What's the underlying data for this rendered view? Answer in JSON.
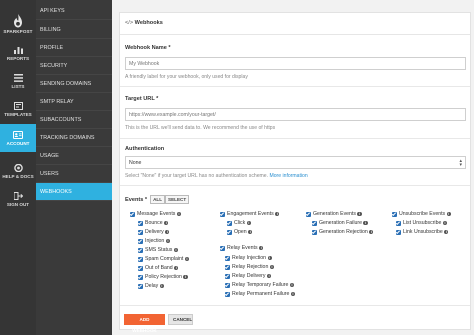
{
  "rail": {
    "logo": "SPARKPOST",
    "items": [
      {
        "label": "REPORTS",
        "icon": "bar-chart-icon"
      },
      {
        "label": "LISTS",
        "icon": "list-icon"
      },
      {
        "label": "TEMPLATES",
        "icon": "template-icon"
      },
      {
        "label": "ACCOUNT",
        "icon": "account-icon"
      },
      {
        "label": "HELP & DOCS",
        "icon": "help-icon"
      },
      {
        "label": "SIGN OUT",
        "icon": "sign-out-icon"
      }
    ]
  },
  "subnav": {
    "items": [
      "API KEYS",
      "BILLING",
      "PROFILE",
      "SECURITY",
      "SENDING DOMAINS",
      "SMTP RELAY",
      "SUBACCOUNTS",
      "TRACKING DOMAINS",
      "USAGE",
      "USERS",
      "WEBHOOKS"
    ],
    "active": "WEBHOOKS"
  },
  "page": {
    "title_icon": "</>",
    "title": "Webhooks",
    "name_label": "Webhook Name *",
    "name_placeholder": "My Webhook",
    "name_hint": "A friendly label for your webhook, only used for display",
    "url_label": "Target URL *",
    "url_placeholder": "https://www.example.com/your-target/",
    "url_hint": "This is the URL we'll send data to. We recommend the use of https",
    "auth_label": "Authentication",
    "auth_value": "None",
    "auth_hint": "Select \"None\" if your target URL has no authentication scheme.",
    "auth_hint_link": "More information",
    "events_label": "Events *",
    "all_button": "ALL",
    "select_button": "SELECT",
    "add_button": "ADD WEBHOOK",
    "cancel_button": "CANCEL"
  },
  "events": {
    "message": {
      "title": "Message Events",
      "items": [
        "Bounce",
        "Delivery",
        "Injection",
        "SMS Status",
        "Spam Complaint",
        "Out of Band",
        "Policy Rejection",
        "Delay"
      ]
    },
    "engagement": {
      "title": "Engagement Events",
      "items": [
        "Click",
        "Open"
      ]
    },
    "relay": {
      "title": "Relay Events",
      "items": [
        "Relay Injection",
        "Relay Rejection",
        "Relay Delivery",
        "Relay Temporary Failure",
        "Relay Permanent Failure"
      ]
    },
    "generation": {
      "title": "Generation Events",
      "items": [
        "Generation Failure",
        "Generation Rejection"
      ]
    },
    "unsubscribe": {
      "title": "Unsubscribe Events",
      "items": [
        "List Unsubscribe",
        "Link Unsubscribe"
      ]
    }
  },
  "colors": {
    "accent": "#2fb1e0",
    "primary_button": "#f26433",
    "checkbox": "#2a6fb5",
    "rail": "#353535"
  }
}
